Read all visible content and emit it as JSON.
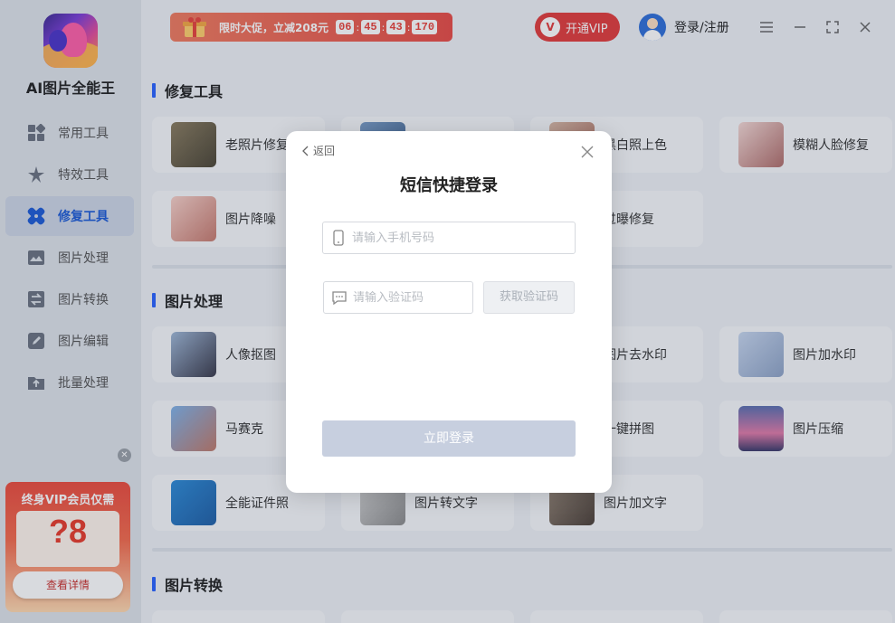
{
  "app": {
    "name": "AI图片全能王"
  },
  "sidebar": {
    "items": [
      {
        "label": "常用工具",
        "icon": "grid-icon"
      },
      {
        "label": "特效工具",
        "icon": "sparkle-icon"
      },
      {
        "label": "修复工具",
        "icon": "bandage-icon",
        "active": true
      },
      {
        "label": "图片处理",
        "icon": "image-icon"
      },
      {
        "label": "图片转换",
        "icon": "convert-icon"
      },
      {
        "label": "图片编辑",
        "icon": "edit-icon"
      },
      {
        "label": "批量处理",
        "icon": "folder-upload-icon"
      }
    ],
    "promo": {
      "title": "终身VIP会员仅需",
      "price": "?8",
      "button": "查看详情"
    }
  },
  "topbar": {
    "sale": {
      "text": "限时大促，立减208元",
      "timer": [
        "06",
        "45",
        "43",
        "170"
      ]
    },
    "vip_label": "开通VIP",
    "login_label": "登录/注册"
  },
  "sections": [
    {
      "title": "修复工具"
    },
    {
      "title": "图片处理"
    },
    {
      "title": "图片转换"
    }
  ],
  "cards": {
    "repair": [
      {
        "label": "老照片修复"
      },
      {
        "label": "黑白照上色"
      },
      {
        "label": "模糊人脸修复"
      },
      {
        "label": "图片降噪"
      },
      {
        "label": "过曝修复"
      }
    ],
    "process": [
      {
        "label": "人像抠图"
      },
      {
        "label": "图片去水印"
      },
      {
        "label": "图片加水印"
      },
      {
        "label": "马赛克"
      },
      {
        "label": "一键拼图"
      },
      {
        "label": "图片压缩"
      },
      {
        "label": "全能证件照"
      },
      {
        "label": "图片转文字"
      },
      {
        "label": "图片加文字"
      }
    ]
  },
  "modal": {
    "back_label": "返回",
    "title": "短信快捷登录",
    "phone_placeholder": "请输入手机号码",
    "code_placeholder": "请输入验证码",
    "get_code_label": "获取验证码",
    "login_label": "立即登录"
  },
  "colors": {
    "accent": "#2962ff",
    "vip": "#e23b3b",
    "login_disabled": "#c7cfdf"
  }
}
